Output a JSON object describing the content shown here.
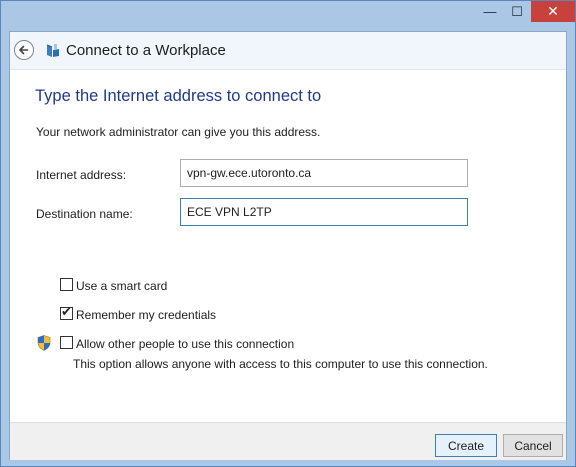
{
  "window": {
    "controls": {
      "minimize": "—",
      "maximize": "☐",
      "close": "✕"
    }
  },
  "header": {
    "back_icon": "back-arrow-icon",
    "app_icon": "vpn-workplace-icon",
    "title": "Connect to a Workplace"
  },
  "main": {
    "heading": "Type the Internet address to connect to",
    "subtext": "Your network administrator can give you this address.",
    "internet_address": {
      "label": "Internet address:",
      "value": "vpn-gw.ece.utoronto.ca"
    },
    "destination_name": {
      "label": "Destination name:",
      "value": "ECE VPN L2TP"
    },
    "options": {
      "smart_card": {
        "label": "Use a smart card",
        "checked": false
      },
      "remember": {
        "label": "Remember my credentials",
        "checked": true
      },
      "allow_others": {
        "label": "Allow other people to use this connection",
        "checked": false
      }
    },
    "note": "This option allows anyone with access to this computer to use this connection.",
    "shield_icon": "uac-shield-icon"
  },
  "footer": {
    "create_label": "Create",
    "cancel_label": "Cancel"
  },
  "colors": {
    "frame": "#abc7e6",
    "heading": "#1e3b8a",
    "close_button": "#c7423d",
    "focus_border": "#3c7fb1"
  }
}
